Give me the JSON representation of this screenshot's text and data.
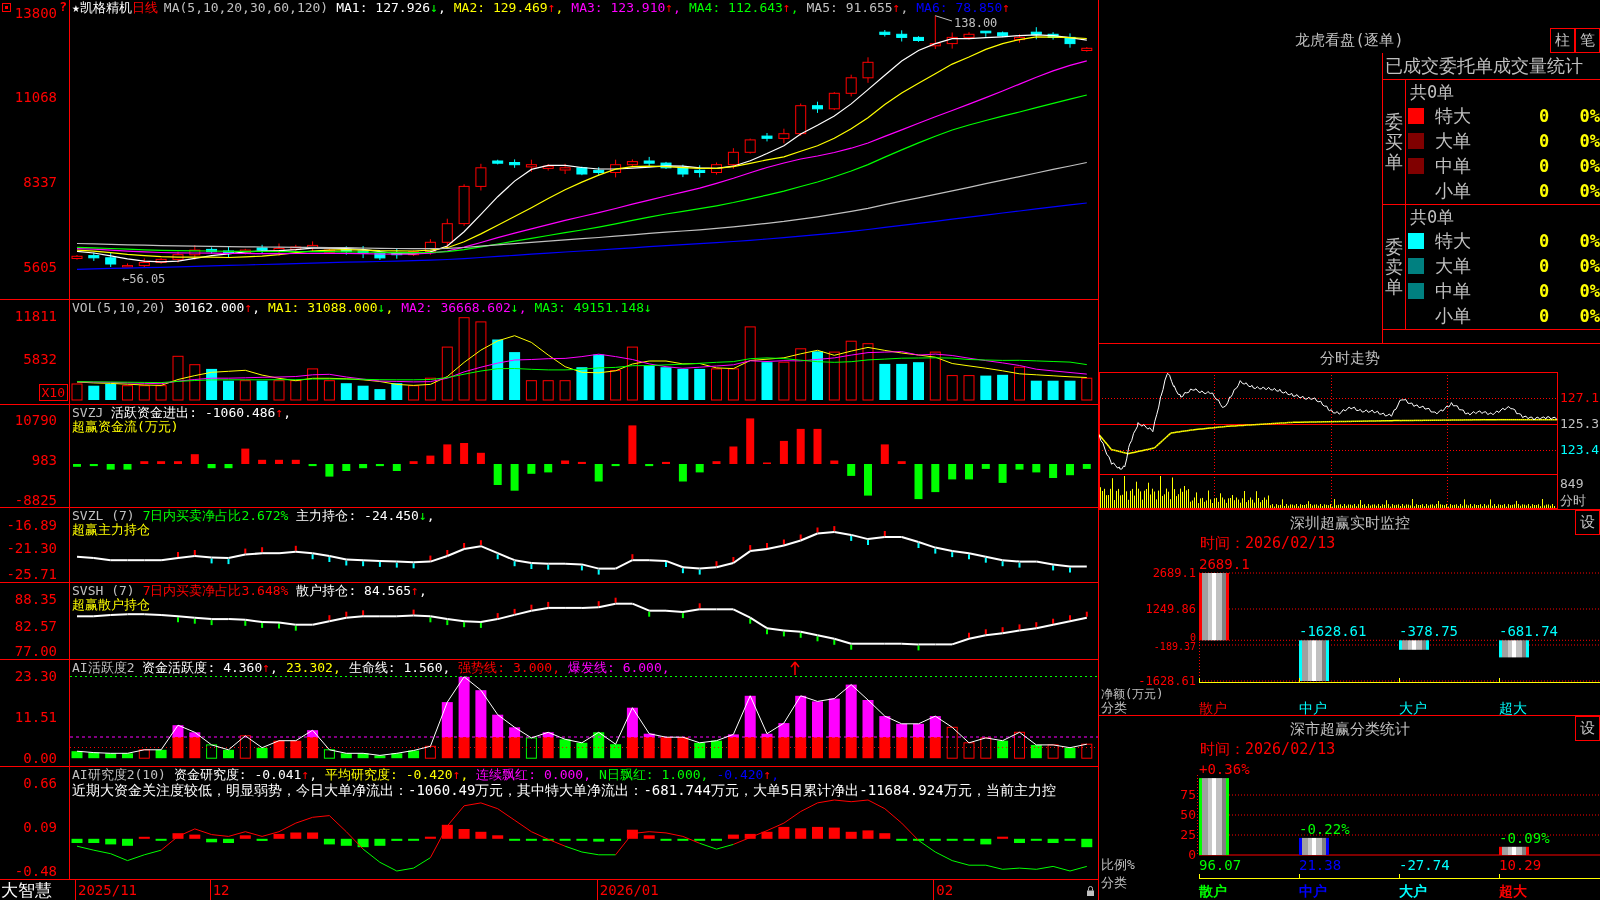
{
  "main_chart": {
    "corner_mark": "?",
    "stock_name": "★凯格精机",
    "period": "日线",
    "ma_params": "MA(5,10,20,30,60,120)",
    "legend": [
      {
        "label": "MA1: 127.926",
        "color": "#ffffff",
        "arrow": "↓",
        "rising": false,
        "separator": ","
      },
      {
        "label": "MA2: 129.469",
        "color": "#ffff00",
        "arrow": "↑",
        "rising": true,
        "separator": ","
      },
      {
        "label": "MA3: 123.910",
        "color": "#ff00ff",
        "arrow": "↑",
        "rising": true,
        "separator": ","
      },
      {
        "label": "MA4: 112.643",
        "color": "#00ff00",
        "arrow": "↑",
        "rising": true,
        "separator": ","
      },
      {
        "label": "MA5: 91.655",
        "color": "#c0c0c0",
        "arrow": "↑",
        "rising": true,
        "separator": ","
      },
      {
        "label": "MA6: 78.850",
        "color": "#0000ff",
        "arrow": "↑",
        "rising": true
      }
    ],
    "high_label": "138.00",
    "low_label": "←56.05",
    "y_ticks": [
      "13800",
      "11068",
      "8337",
      "5605"
    ]
  },
  "volume_pane": {
    "title": "VOL(5,10,20)",
    "legend": [
      {
        "label": "30162.000",
        "color": "#ffffff",
        "arrow": "↑",
        "rising": true,
        "separator": ","
      },
      {
        "label": "MA1: 31088.000",
        "color": "#ffff00",
        "arrow": "↓",
        "rising": false,
        "separator": ","
      },
      {
        "label": "MA2: 36668.602",
        "color": "#ff00ff",
        "arrow": "↓",
        "rising": false,
        "separator": ","
      },
      {
        "label": "MA3: 49151.148",
        "color": "#00ff00",
        "arrow": "↓",
        "rising": false
      }
    ],
    "y_ticks": [
      "11811",
      "5832"
    ],
    "scale_button": "X10"
  },
  "indicator_panes": [
    {
      "kind": "flow",
      "title": "SVZJ",
      "legend": [
        {
          "label": "活跃资金进出: -1060.486",
          "color": "#ffffff",
          "arrow": "↑",
          "rising": true,
          "separator": ","
        }
      ],
      "subtitle": "超赢资金流(万元)",
      "y_ticks": [
        "10790",
        "983",
        "-8825"
      ]
    },
    {
      "kind": "holding",
      "title": "SVZL (7)",
      "legend": [
        {
          "label": "7日内买卖净占比2.672%",
          "color": "#00ff00"
        },
        {
          "label": "主力持仓: -24.450",
          "color": "#ffffff",
          "arrow": "↓",
          "rising": false,
          "separator": ","
        }
      ],
      "subtitle": "超赢主力持仓",
      "y_ticks": [
        "-16.89",
        "-21.30",
        "-25.71"
      ]
    },
    {
      "kind": "holding",
      "title": "SVSH (7)",
      "legend": [
        {
          "label": "7日内买卖净占比3.648%",
          "color": "#ff0000"
        },
        {
          "label": "散户持仓: 84.565",
          "color": "#ffffff",
          "arrow": "↑",
          "rising": true,
          "separator": ","
        }
      ],
      "subtitle": "超赢散户持仓",
      "y_ticks": [
        "88.35",
        "82.57",
        "77.00"
      ]
    },
    {
      "kind": "activity",
      "title": "AI活跃度2",
      "legend": [
        {
          "label": "资金活跃度: 4.360",
          "color": "#ffffff",
          "arrow": "↑",
          "rising": true,
          "separator": ","
        },
        {
          "label": "23.302",
          "color": "#ffff00",
          "separator": ","
        },
        {
          "label": "生命线: 1.560",
          "color": "#ffffff",
          "separator": ","
        },
        {
          "label": "强势线: 3.000",
          "color": "#ff0000",
          "separator": ","
        },
        {
          "label": "爆发线: 6.000",
          "color": "#ff00ff",
          "separator": ","
        }
      ],
      "y_ticks": [
        "23.30",
        "11.51",
        "0.00"
      ]
    },
    {
      "kind": "research",
      "title": "AI研究度2(10)",
      "legend": [
        {
          "label": "资金研究度: -0.041",
          "color": "#ffffff",
          "arrow": "↑",
          "rising": true,
          "separator": ","
        },
        {
          "label": "平均研究度: -0.420",
          "color": "#ffff00",
          "arrow": "↑",
          "rising": true,
          "separator": ","
        },
        {
          "label": "连续飘红: 0.000",
          "color": "#ff00ff",
          "separator": ","
        },
        {
          "label": "N日飘红: 1.000",
          "color": "#00ff00",
          "separator": ","
        },
        {
          "label": "-0.420",
          "color": "#0000ff",
          "arrow": "↑",
          "rising": true,
          "separator": ","
        }
      ],
      "note": "近期大资金关注度较低，明显弱势，今日大单净流出：-1060.49万元，其中特大单净流出：-681.744万元，大单5日累计净出-11684.924万元，当前主力控",
      "y_ticks": [
        "0.66",
        "0.09",
        "-0.48"
      ]
    }
  ],
  "time_axis": {
    "brand": "大智慧",
    "dates": [
      "2025/11",
      "12",
      "2026/01",
      "02"
    ]
  },
  "dragon_tiger": {
    "title": "龙虎看盘(逐单)",
    "view_buttons": [
      "柱",
      "笔"
    ],
    "stats_title": "已成交委托单成交量统计",
    "groups": [
      {
        "side": "委买单",
        "total": "共0单",
        "rows": [
          {
            "label": "特大",
            "color": "#ff0000",
            "count": "0",
            "share": "0%"
          },
          {
            "label": "大单",
            "color": "#800000",
            "count": "0",
            "share": "0%"
          },
          {
            "label": "中单",
            "color": "#800000",
            "count": "0",
            "share": "0%"
          },
          {
            "label": "小单",
            "count": "0",
            "share": "0%"
          }
        ]
      },
      {
        "side": "委卖单",
        "total": "共0单",
        "rows": [
          {
            "label": "特大",
            "color": "#00ffff",
            "count": "0",
            "share": "0%"
          },
          {
            "label": "大单",
            "color": "#008080",
            "count": "0",
            "share": "0%"
          },
          {
            "label": "中单",
            "color": "#008080",
            "count": "0",
            "share": "0%"
          },
          {
            "label": "小单",
            "count": "0",
            "share": "0%"
          }
        ]
      }
    ]
  },
  "intraday": {
    "title": "分时走势",
    "price_ticks": [
      {
        "label": "127.1",
        "color": "#ff0000"
      },
      {
        "label": "125.3",
        "color": "#c0c0c0"
      },
      {
        "label": "123.4",
        "color": "#00ffff"
      }
    ],
    "volume_tick": "849",
    "volume_label": "分时"
  },
  "sz_monitor": {
    "title": "深圳超赢实时监控",
    "settings_button": "设",
    "time": "时间：2026/02/13",
    "chart_data": {
      "type": "bar",
      "ylabel": "净额(万元)",
      "xlabel": "分类",
      "categories": [
        "散户",
        "中户",
        "大户",
        "超大"
      ],
      "values": [
        2689.1,
        -1628.61,
        -378.75,
        -681.74
      ],
      "ylim": [
        -1628.61,
        2689.1
      ],
      "yticks": [
        {
          "value": 2689.1,
          "label": "2689.1"
        },
        {
          "value": 1249.86,
          "label": "1249.86"
        },
        {
          "value": 0,
          "label": "0"
        },
        {
          "value": -189.37,
          "label": "-189.37"
        },
        {
          "value": -1628.61,
          "label": "-1628.61"
        }
      ],
      "grid": true,
      "value_labels": [
        "2689.1",
        "-1628.61",
        "-378.75",
        "-681.74"
      ]
    }
  },
  "sz_stats": {
    "title": "深市超赢分类统计",
    "settings_button": "设",
    "time": "时间：2026/02/13",
    "category_styles": [
      {
        "color": "#00ff00",
        "change": {
          "text": "+0.36%",
          "rising": true
        }
      },
      {
        "color": "#0000ff",
        "change": {
          "text": "-0.22%",
          "rising": false
        }
      },
      {
        "color": "#00ffff"
      },
      {
        "color": "#ff0000",
        "change": {
          "text": "-0.09%",
          "rising": false
        }
      }
    ],
    "chart_data": {
      "type": "bar",
      "ylabel": "比例%",
      "xlabel": "分类",
      "categories": [
        "散户",
        "中户",
        "大户",
        "超大"
      ],
      "values": [
        96.07,
        21.38,
        null,
        10.29
      ],
      "ylim": [
        0,
        100
      ],
      "yticks": [
        0,
        25,
        50,
        75
      ],
      "grid": true,
      "value_labels": [
        "96.07",
        "21.38",
        "-27.74",
        "10.29"
      ]
    }
  }
}
